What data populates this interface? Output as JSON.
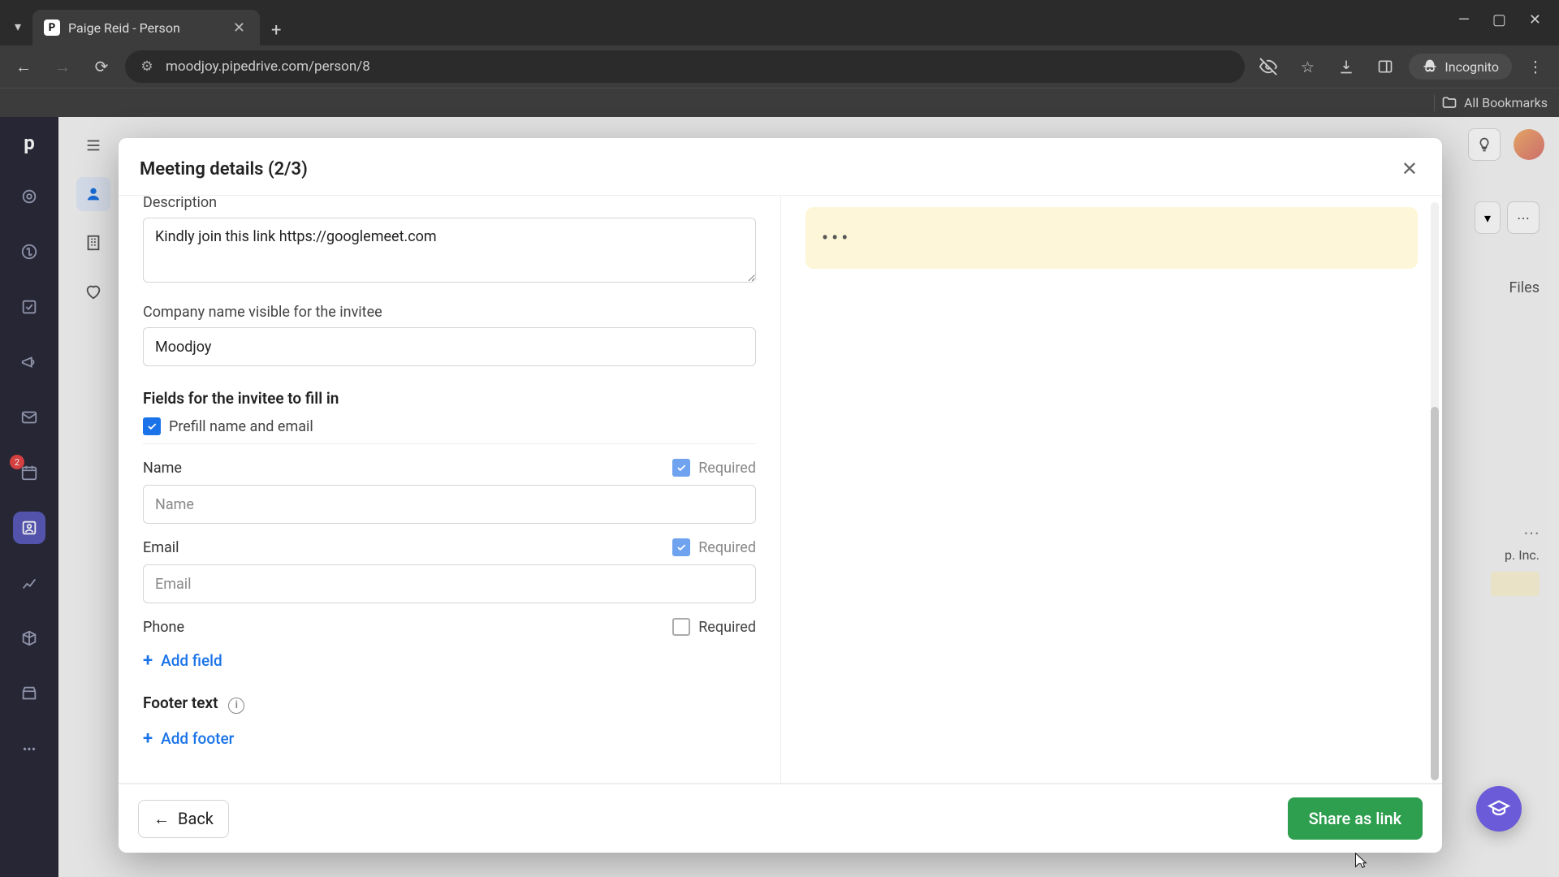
{
  "browser": {
    "tab_title": "Paige Reid - Person",
    "url": "moodjoy.pipedrive.com/person/8",
    "incognito_label": "Incognito",
    "bookmarks_label": "All Bookmarks"
  },
  "rail": {
    "badge_count": "2"
  },
  "bg": {
    "files_tab": "Files",
    "org_hint": "p. Inc."
  },
  "modal": {
    "title": "Meeting details (2/3)",
    "description_label": "Description",
    "description_value": "Kindly join this link https://googlemeet.com",
    "company_label": "Company name visible for the invitee",
    "company_value": "Moodjoy",
    "fields_section": "Fields for the invitee to fill in",
    "prefill_label": "Prefill name and email",
    "fields": [
      {
        "label": "Name",
        "required": true,
        "required_label": "Required",
        "placeholder": "Name",
        "show_input": true
      },
      {
        "label": "Email",
        "required": true,
        "required_label": "Required",
        "placeholder": "Email",
        "show_input": true
      },
      {
        "label": "Phone",
        "required": false,
        "required_label": "Required",
        "placeholder": "",
        "show_input": false
      }
    ],
    "add_field": "Add field",
    "footer_label": "Footer text",
    "add_footer": "Add footer",
    "back": "Back",
    "share": "Share as link",
    "preview_placeholder": "•••"
  }
}
